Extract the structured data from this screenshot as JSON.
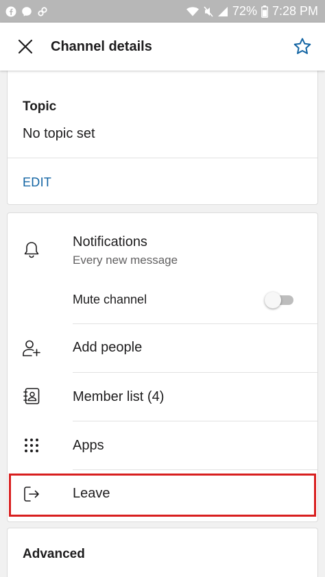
{
  "status_bar": {
    "battery": "72%",
    "time": "7:28 PM",
    "icons": [
      "facebook-icon",
      "messenger-icon",
      "link-icon",
      "wifi-icon",
      "mute-icon",
      "signal-icon",
      "battery-icon"
    ]
  },
  "header": {
    "title": "Channel details",
    "close_icon": "close-icon",
    "star_icon": "star-icon"
  },
  "topic": {
    "label": "Topic",
    "value": "No topic set",
    "edit_label": "EDIT"
  },
  "menu": {
    "notifications": {
      "label": "Notifications",
      "sub": "Every new message",
      "icon": "bell-icon"
    },
    "mute": {
      "label": "Mute channel",
      "enabled": false
    },
    "add_people": {
      "label": "Add people",
      "icon": "add-person-icon"
    },
    "member_list": {
      "label": "Member list (4)",
      "icon": "contacts-icon"
    },
    "apps": {
      "label": "Apps",
      "icon": "grid-dots-icon"
    },
    "leave": {
      "label": "Leave",
      "icon": "leave-icon"
    }
  },
  "advanced": {
    "label": "Advanced"
  },
  "colors": {
    "accent": "#1264a3",
    "highlight": "#d81e1e",
    "status_bar": "#b7b7b7",
    "star": "#1264a3"
  }
}
